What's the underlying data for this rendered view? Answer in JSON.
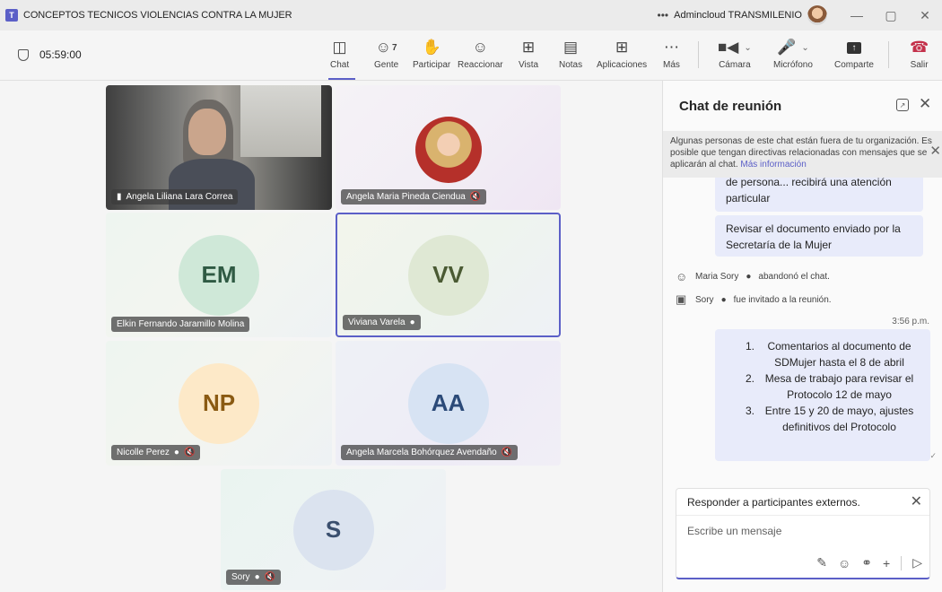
{
  "window": {
    "title": "CONCEPTOS TECNICOS VIOLENCIAS CONTRA LA MUJER",
    "more": "•••",
    "account": "Admincloud TRANSMILENIO",
    "minimize": "—",
    "maximize": "▢",
    "close": "✕"
  },
  "toolbar": {
    "timer": "05:59:00",
    "chat": "Chat",
    "people": "Gente",
    "people_count": "7",
    "raise": "Participar",
    "react": "Reaccionar",
    "view": "Vista",
    "notes": "Notas",
    "apps": "Aplicaciones",
    "more": "Más",
    "camera": "Cámara",
    "mic": "Micrófono",
    "share": "Comparte",
    "leave": "Salir"
  },
  "participants": [
    {
      "name": "Angela Liliana Lara Correa"
    },
    {
      "name": "Angela Maria Pineda Ciendua"
    },
    {
      "name": "Elkin Fernando Jaramillo Molina",
      "initials": "EM",
      "color": "#cfe8d8",
      "text_color": "#2f5a43"
    },
    {
      "name": "Viviana Varela",
      "initials": "VV",
      "color": "#dfe8d4",
      "text_color": "#4a5a33"
    },
    {
      "name": "Nicolle Perez",
      "initials": "NP",
      "color": "#fde9c8",
      "text_color": "#8a5a12"
    },
    {
      "name": "Angela Marcela Bohórquez Avendaño",
      "initials": "AA",
      "color": "#d7e3f3",
      "text_color": "#2b4a78"
    },
    {
      "name": "Sory",
      "initials": "S",
      "color": "#dbe3ef",
      "text_color": "#3a4f6e"
    }
  ],
  "chat": {
    "title": "Chat de reunión",
    "notice": "Algunas personas de este chat están fuera de tu organización. Es posible que tengan directivas relacionadas con mensajes que se aplicarán al chat.",
    "notice_link": "Más información",
    "msg1": "de persona... recibirá una atención particular",
    "msg2": "Revisar el documento enviado por la Secretaría de la Mujer",
    "sys1_name": "Maria Sory",
    "sys1_text": "abandonó el chat.",
    "sys2_name": "Sory",
    "sys2_text": "fue invitado a la reunión.",
    "time": "3:56 p.m.",
    "list": [
      {
        "n": "1.",
        "t": "Comentarios al documento de SDMujer hasta el 8 de abril"
      },
      {
        "n": "2.",
        "t": "Mesa de trabajo para revisar el Protocolo 12 de mayo"
      },
      {
        "n": "3.",
        "t": "Entre 15 y 20 de mayo, ajustes definitivos del Protocolo"
      }
    ],
    "reply_label": "Responder a participantes externos.",
    "compose_placeholder": "Escribe un mensaje"
  }
}
